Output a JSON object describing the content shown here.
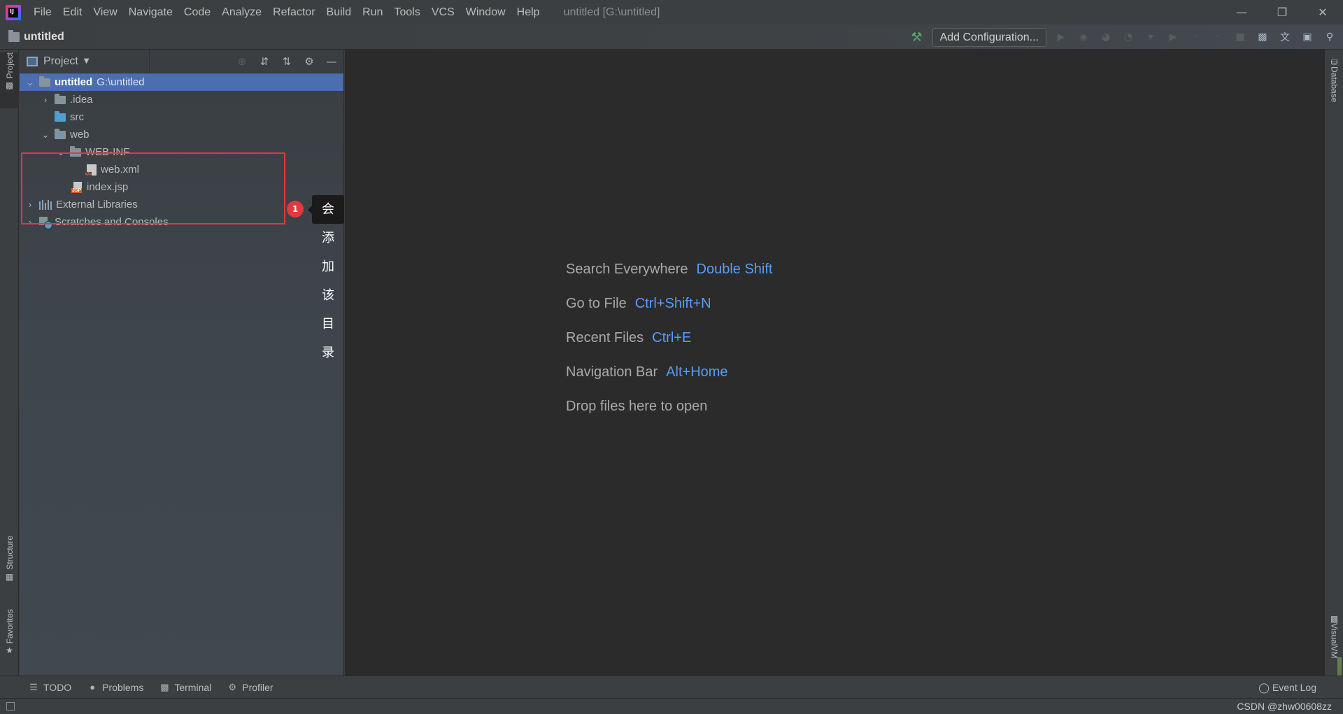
{
  "app": {
    "logo_text": "IJ"
  },
  "menu": [
    "File",
    "Edit",
    "View",
    "Navigate",
    "Code",
    "Analyze",
    "Refactor",
    "Build",
    "Run",
    "Tools",
    "VCS",
    "Window",
    "Help"
  ],
  "window_title": "untitled [G:\\untitled]",
  "window_controls": {
    "minimize": "—",
    "restore": "❐",
    "close": "✕"
  },
  "navbar": {
    "breadcrumb": "untitled",
    "add_config_label": "Add Configuration..."
  },
  "left_stripe": {
    "project": "Project",
    "structure": "Structure",
    "favorites": "Favorites"
  },
  "right_stripe": {
    "database": "Database",
    "visualvm": "VisualVM"
  },
  "project_panel": {
    "title": "Project",
    "tree": {
      "root_name": "untitled",
      "root_path": "G:\\untitled",
      "idea": ".idea",
      "src": "src",
      "web": "web",
      "web_inf": "WEB-INF",
      "web_xml": "web.xml",
      "index_jsp": "index.jsp",
      "external_libraries": "External Libraries",
      "scratches": "Scratches and Consoles"
    }
  },
  "annotation": {
    "badge": "1",
    "text": "会添加该目录",
    "color": "#e0393e"
  },
  "editor_hints": [
    {
      "label": "Search Everywhere",
      "key": "Double Shift"
    },
    {
      "label": "Go to File",
      "key": "Ctrl+Shift+N"
    },
    {
      "label": "Recent Files",
      "key": "Ctrl+E"
    },
    {
      "label": "Navigation Bar",
      "key": "Alt+Home"
    },
    {
      "label": "Drop files here to open",
      "key": ""
    }
  ],
  "bottom_tabs": [
    "TODO",
    "Problems",
    "Terminal",
    "Profiler"
  ],
  "event_log": "Event Log",
  "watermark": "CSDN @zhw00608zz",
  "colors": {
    "accent": "#589df6",
    "selection": "#4b6eaf",
    "editor_bg": "#2b2b2b",
    "panel_bg": "#3c3f41"
  }
}
